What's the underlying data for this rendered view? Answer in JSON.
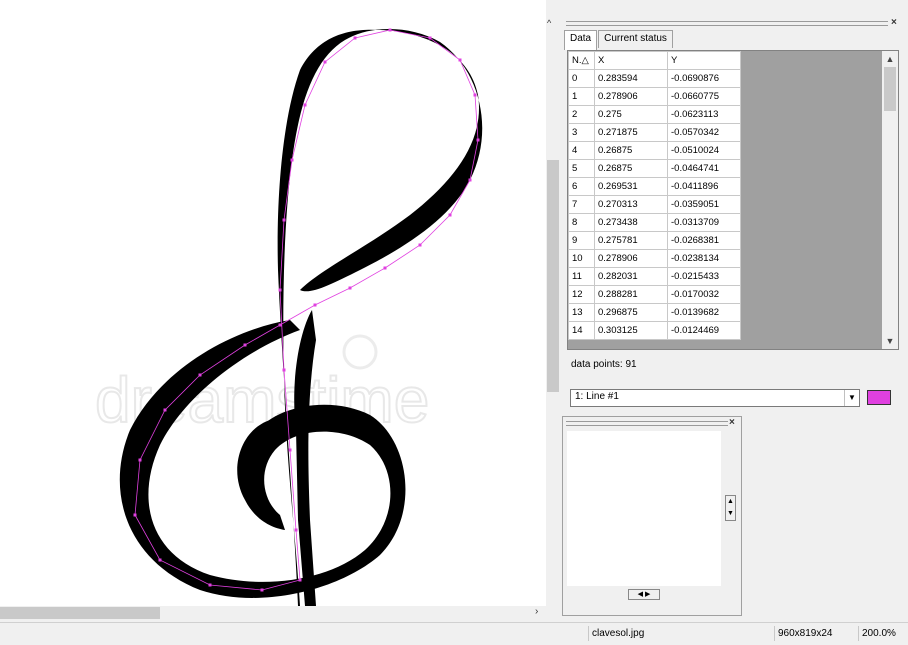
{
  "tabs": [
    {
      "label": "Data",
      "active": true
    },
    {
      "label": "Current status",
      "active": false
    }
  ],
  "table": {
    "columns": [
      "N.△",
      "X",
      "Y"
    ],
    "rows": [
      {
        "n": "0",
        "x": "0.283594",
        "y": "-0.0690876"
      },
      {
        "n": "1",
        "x": "0.278906",
        "y": "-0.0660775"
      },
      {
        "n": "2",
        "x": "0.275",
        "y": "-0.0623113"
      },
      {
        "n": "3",
        "x": "0.271875",
        "y": "-0.0570342"
      },
      {
        "n": "4",
        "x": "0.26875",
        "y": "-0.0510024"
      },
      {
        "n": "5",
        "x": "0.26875",
        "y": "-0.0464741"
      },
      {
        "n": "6",
        "x": "0.269531",
        "y": "-0.0411896"
      },
      {
        "n": "7",
        "x": "0.270313",
        "y": "-0.0359051"
      },
      {
        "n": "8",
        "x": "0.273438",
        "y": "-0.0313709"
      },
      {
        "n": "9",
        "x": "0.275781",
        "y": "-0.0268381"
      },
      {
        "n": "10",
        "x": "0.278906",
        "y": "-0.0238134"
      },
      {
        "n": "11",
        "x": "0.282031",
        "y": "-0.0215433"
      },
      {
        "n": "12",
        "x": "0.288281",
        "y": "-0.0170032"
      },
      {
        "n": "13",
        "x": "0.296875",
        "y": "-0.0139682"
      },
      {
        "n": "14",
        "x": "0.303125",
        "y": "-0.0124469"
      }
    ]
  },
  "data_points_label": "data points: 91",
  "line_select": {
    "value": "1: Line #1"
  },
  "line_color": "#e040e0",
  "status": {
    "file": "clavesol.jpg",
    "dims": "960x819x24",
    "zoom": "200.0%"
  },
  "watermark": "dreamstime"
}
